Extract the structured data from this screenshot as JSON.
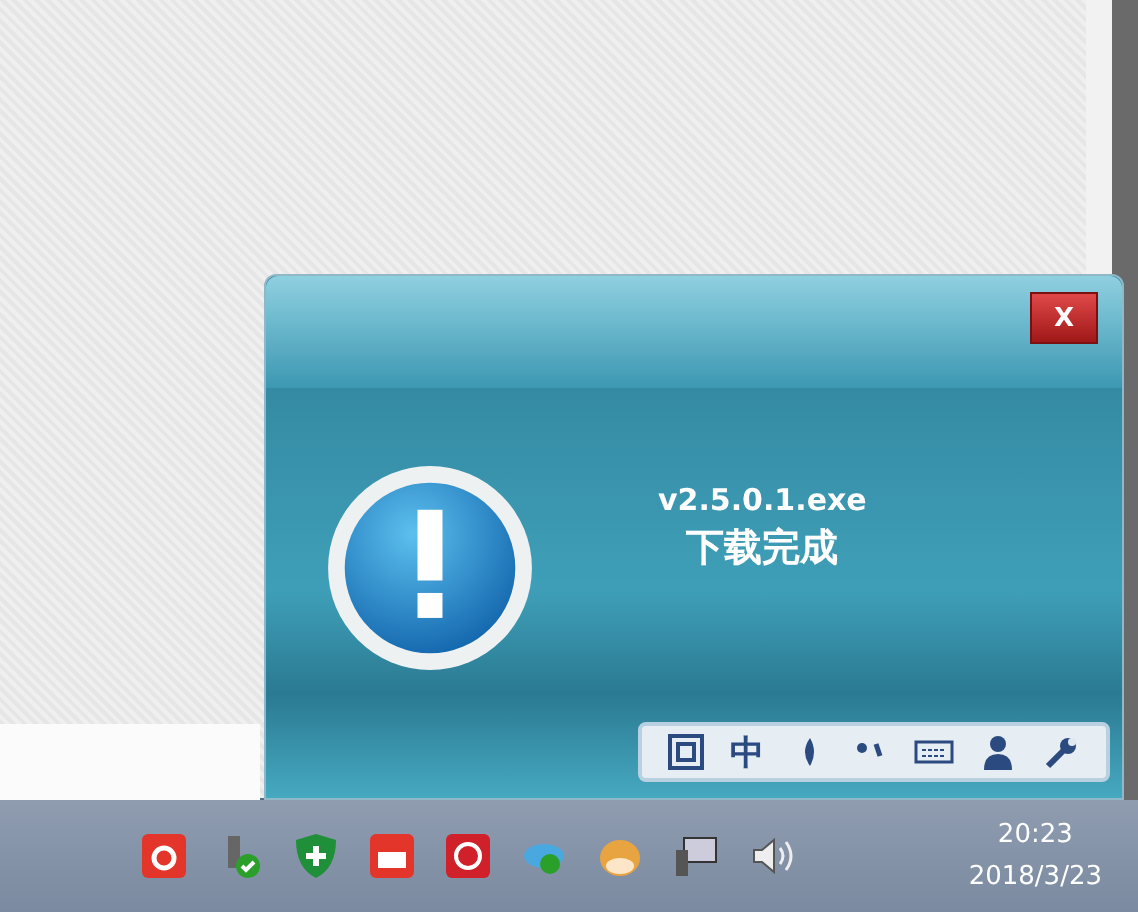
{
  "dialog": {
    "close_label": "X",
    "filename": "v2.5.0.1.exe",
    "status": "下载完成"
  },
  "ime_toolbar": {
    "mode": "中"
  },
  "clock": {
    "time": "20:23",
    "date": "2018/3/23"
  }
}
